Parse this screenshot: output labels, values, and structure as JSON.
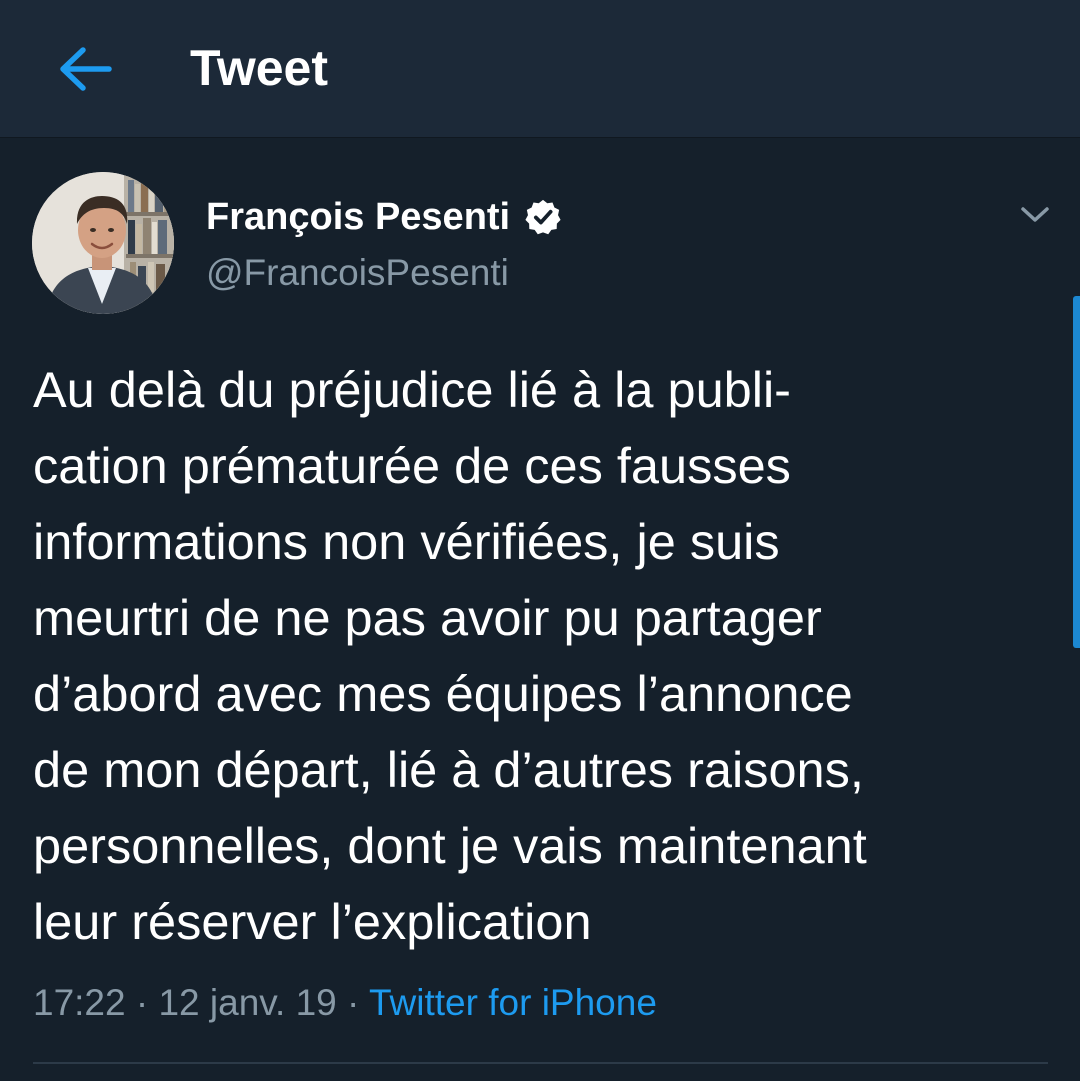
{
  "header": {
    "title": "Tweet",
    "back_icon": "arrow-left-icon"
  },
  "colors": {
    "background": "#15202b",
    "header_background": "#1c2938",
    "accent": "#1d9bf0",
    "secondary_text": "#8899a6"
  },
  "tweet": {
    "author": {
      "name": "François Pesenti",
      "handle": "@FrancoisPesenti",
      "verified": true
    },
    "text_lines": [
      "Au delà du préjudice lié à la publi-",
      "cation prématurée de ces fausses",
      "informations non vérifiées, je suis",
      "meurtri de ne pas avoir pu partager",
      "d’abord avec mes équipes l’annonce",
      "de mon départ, lié à d’autres raisons,",
      "personnelles, dont je vais maintenant",
      "leur réserver l’explication"
    ],
    "time": "17:22",
    "separator": "·",
    "date": "12 janv. 19",
    "source": "Twitter for iPhone"
  }
}
